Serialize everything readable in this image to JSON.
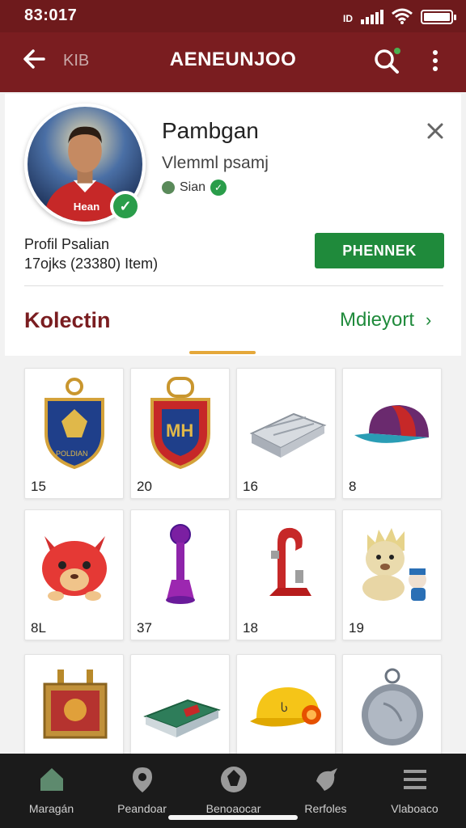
{
  "status_bar": {
    "time": "83:017",
    "network_label": "ID"
  },
  "app_bar": {
    "back_label": "KIB",
    "title": "AENEUNJOO"
  },
  "profile": {
    "name": "Pambgan",
    "meta": "Vlemml psamj",
    "status": "Sian",
    "label": "Profil Psalian",
    "count_text": "17ojks (23380) Item)",
    "action_button": "PHENNEK"
  },
  "collection": {
    "title": "Kolectin",
    "more_label": "Mdieyort"
  },
  "items": [
    {
      "count": "15",
      "icon": "blue-crest-keychain-icon"
    },
    {
      "count": "20",
      "icon": "red-crest-keychain-icon"
    },
    {
      "count": "16",
      "icon": "silver-scarf-icon"
    },
    {
      "count": "8",
      "icon": "cap-icon"
    },
    {
      "count": "8L",
      "icon": "red-plush-icon"
    },
    {
      "count": "37",
      "icon": "purple-trophy-icon"
    },
    {
      "count": "18",
      "icon": "red-stand-icon"
    },
    {
      "count": "19",
      "icon": "lion-figure-icon"
    },
    {
      "count": "",
      "icon": "framed-badge-icon"
    },
    {
      "count": "",
      "icon": "card-pack-icon"
    },
    {
      "count": "",
      "icon": "yellow-helmet-icon"
    },
    {
      "count": "",
      "icon": "silver-medal-icon"
    }
  ],
  "bottom_nav": [
    {
      "label": "Maragán",
      "icon": "home-icon"
    },
    {
      "label": "Peandoar",
      "icon": "location-icon"
    },
    {
      "label": "Benoaocar",
      "icon": "ball-icon"
    },
    {
      "label": "Rerfoles",
      "icon": "bird-icon"
    },
    {
      "label": "Vlaboaco",
      "icon": "menu-icon"
    }
  ],
  "colors": {
    "brand": "#7a1d20",
    "accent_green": "#1f8a3b",
    "indicator": "#e5a83a"
  }
}
